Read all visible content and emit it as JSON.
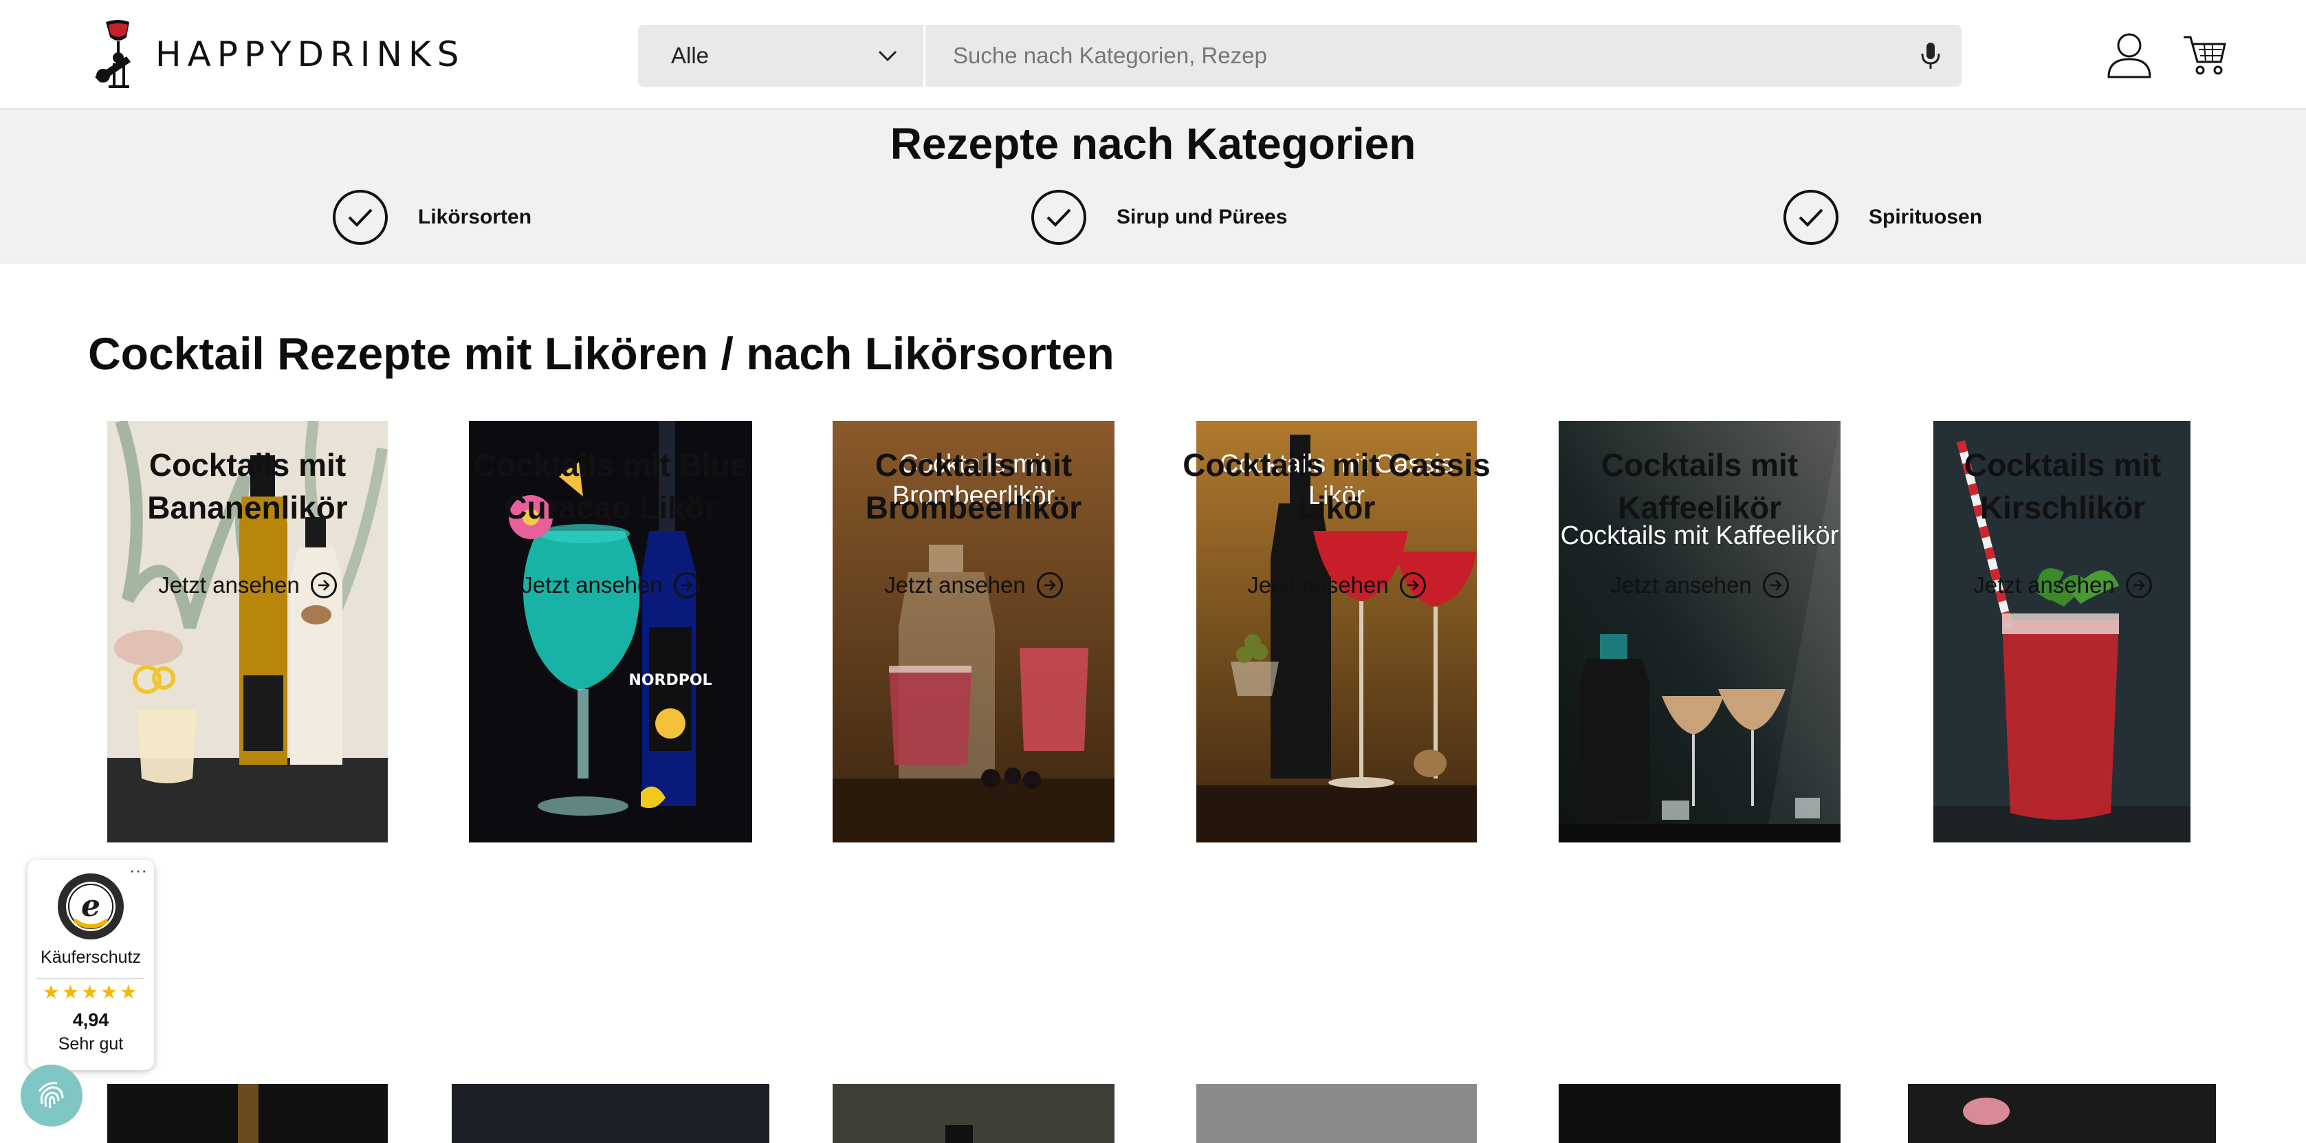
{
  "header": {
    "logo_text": "HAPPYDRINKS",
    "search": {
      "category_selected": "Alle",
      "placeholder": "Suche nach Kategorien, Rezep"
    }
  },
  "categories": {
    "title": "Rezepte nach Kategorien",
    "items": [
      {
        "label": "Likörsorten"
      },
      {
        "label": "Sirup und Pürees"
      },
      {
        "label": "Spirituosen"
      }
    ]
  },
  "section": {
    "title": "Cocktail Rezepte mit Likören / nach Likörsorten",
    "cards": [
      {
        "title": "Cocktails mit Bananenlikör",
        "link": "Jetzt ansehen",
        "overlay": ""
      },
      {
        "title": "Cocktails mit Blue Curacao Likör",
        "link": "Jetzt ansehen",
        "overlay": "",
        "bottle_label": "NORDPOL"
      },
      {
        "title": "Cocktails mit Brombeerlikör",
        "link": "Jetzt ansehen",
        "overlay": "Cocktails mit Brombeerlikör"
      },
      {
        "title": "Cocktails mit Cassis Likör",
        "link": "Jetzt ansehen",
        "overlay": "Cocktails mit Cassis Likör"
      },
      {
        "title": "Cocktails mit Kaffeelikör",
        "link": "Jetzt ansehen",
        "overlay": "Cocktails mit Kaffeelikör"
      },
      {
        "title": "Cocktails mit Kirschlikör",
        "link": "Jetzt ansehen",
        "overlay": ""
      }
    ]
  },
  "trust_badge": {
    "label": "Käuferschutz",
    "stars": "★★★★★",
    "score": "4,94",
    "verdict": "Sehr gut",
    "more": "···"
  },
  "colors": {
    "band": "#f1f1f1",
    "search_bg": "#e9e9e9",
    "star": "#f5b800",
    "fingerprint": "#7fc6c4"
  }
}
